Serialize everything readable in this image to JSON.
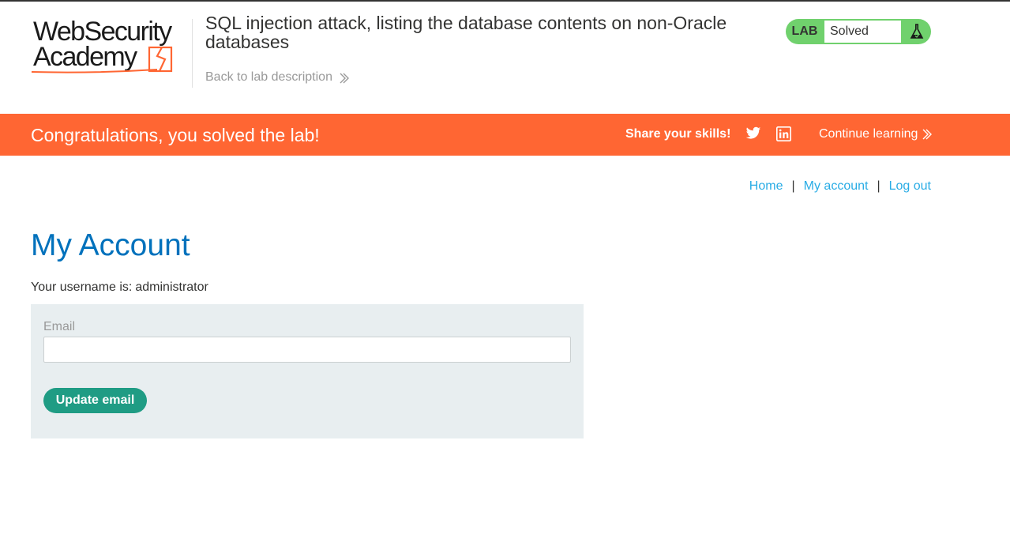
{
  "header": {
    "logo": {
      "line1": "WebSecurity",
      "line2": "Academy"
    },
    "lab_title": "SQL injection attack, listing the database contents on non-Oracle databases",
    "back_link": "Back to lab description",
    "lab_badge": {
      "label": "LAB",
      "status": "Solved"
    }
  },
  "banner": {
    "message": "Congratulations, you solved the lab!",
    "share_label": "Share your skills!",
    "continue_label": "Continue learning"
  },
  "nav": {
    "items": [
      "Home",
      "My account",
      "Log out"
    ],
    "separator": "|"
  },
  "main": {
    "title": "My Account",
    "username_prefix": "Your username is:",
    "username": "administrator",
    "form": {
      "email_label": "Email",
      "email_value": "",
      "submit_label": "Update email"
    }
  },
  "colors": {
    "brand_orange": "#ff6633",
    "lab_green": "#70d16d",
    "title_blue": "#0071bc",
    "link_blue": "#29ace5",
    "button_teal": "#1f9c84",
    "panel_bg": "#e8eef0"
  },
  "icons": [
    "flask-icon",
    "twitter-icon",
    "linkedin-icon",
    "double-chevron-right-icon"
  ]
}
